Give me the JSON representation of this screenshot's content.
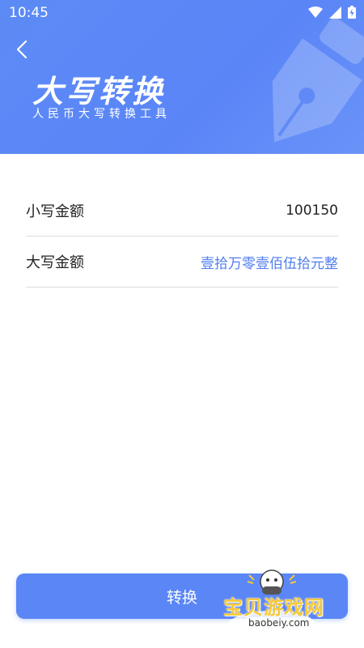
{
  "status_bar": {
    "time": "10:45",
    "icons": [
      "wifi-icon",
      "signal-icon",
      "battery-icon"
    ]
  },
  "header": {
    "back_icon": "chevron-left-icon",
    "title": "大写转换",
    "subtitle": "人民币大写转换工具"
  },
  "form": {
    "lowercase_label": "小写金额",
    "lowercase_value": "100150",
    "uppercase_label": "大写金额",
    "uppercase_value": "壹拾万零壹佰伍拾元整"
  },
  "actions": {
    "convert_label": "转换"
  },
  "watermark": {
    "text": "宝贝游戏网",
    "url": "baobeiy.com"
  },
  "colors": {
    "accent": "#5a86f6",
    "result_text": "#4f7df0"
  }
}
